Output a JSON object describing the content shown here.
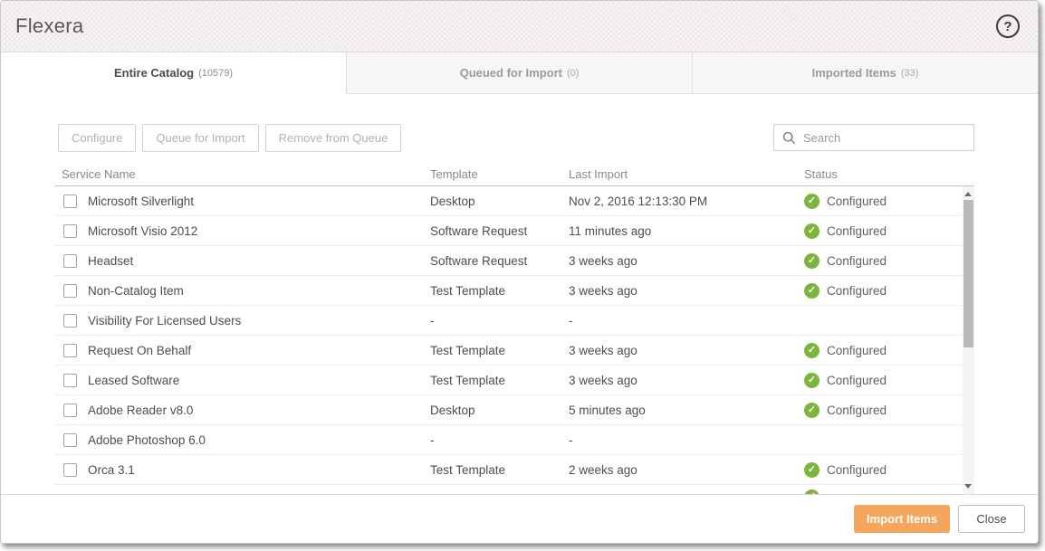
{
  "window": {
    "title": "Flexera",
    "help_label": "?"
  },
  "tabs": [
    {
      "label": "Entire Catalog",
      "count": "(10579)",
      "active": true
    },
    {
      "label": "Queued for Import",
      "count": "(0)",
      "active": false
    },
    {
      "label": "Imported Items",
      "count": "(33)",
      "active": false
    }
  ],
  "toolbar": {
    "buttons": [
      {
        "label": "Configure"
      },
      {
        "label": "Queue for Import"
      },
      {
        "label": "Remove from Queue"
      }
    ],
    "search": {
      "placeholder": "Search",
      "value": ""
    }
  },
  "table": {
    "columns": [
      "Service Name",
      "Template",
      "Last Import",
      "Status"
    ],
    "status_icon_glyph": "✓",
    "rows": [
      {
        "name": "Microsoft Silverlight",
        "template": "Desktop",
        "last_import": "Nov 2, 2016 12:13:30 PM",
        "status": "Configured",
        "checked": false
      },
      {
        "name": "Microsoft Visio 2012",
        "template": "Software Request",
        "last_import": "11 minutes ago",
        "status": "Configured",
        "checked": false
      },
      {
        "name": "Headset",
        "template": "Software Request",
        "last_import": "3 weeks ago",
        "status": "Configured",
        "checked": false
      },
      {
        "name": "Non-Catalog Item",
        "template": "Test Template",
        "last_import": "3 weeks ago",
        "status": "Configured",
        "checked": false
      },
      {
        "name": "Visibility For Licensed Users",
        "template": "-",
        "last_import": "-",
        "status": "",
        "checked": false
      },
      {
        "name": "Request On Behalf",
        "template": "Test Template",
        "last_import": "3 weeks ago",
        "status": "Configured",
        "checked": false
      },
      {
        "name": "Leased Software",
        "template": "Test Template",
        "last_import": "3 weeks ago",
        "status": "Configured",
        "checked": false
      },
      {
        "name": "Adobe Reader v8.0",
        "template": "Desktop",
        "last_import": "5 minutes ago",
        "status": "Configured",
        "checked": false
      },
      {
        "name": "Adobe Photoshop 6.0",
        "template": "-",
        "last_import": "-",
        "status": "",
        "checked": false
      },
      {
        "name": "Orca 3.1",
        "template": "Test Template",
        "last_import": "2 weeks ago",
        "status": "Configured",
        "checked": false
      }
    ],
    "partial_row_visible": true
  },
  "footer": {
    "import_label": "Import Items",
    "close_label": "Close"
  },
  "colors": {
    "status_green": "#7cb53c",
    "accent_orange": "#f6a55c"
  }
}
